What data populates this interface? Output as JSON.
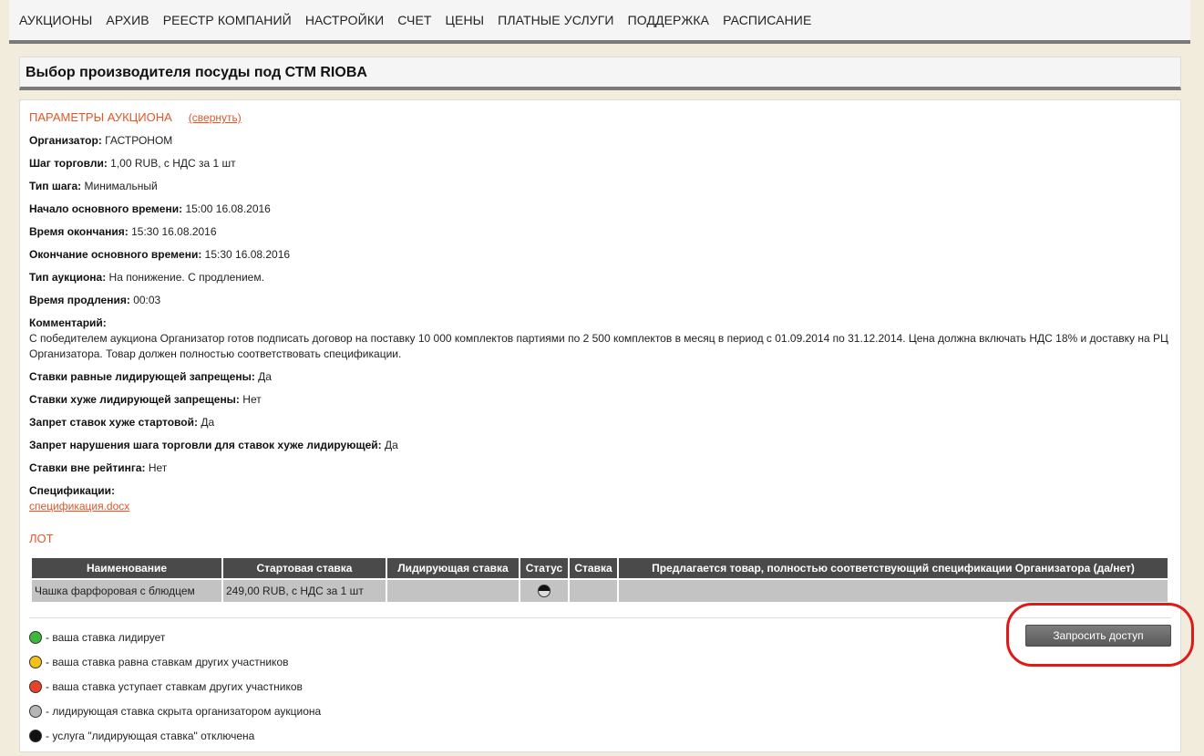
{
  "nav": {
    "items": [
      "АУКЦИОНЫ",
      "АРХИВ",
      "РЕЕСТР КОМПАНИЙ",
      "НАСТРОЙКИ",
      "СЧЕТ",
      "ЦЕНЫ",
      "ПЛАТНЫЕ УСЛУГИ",
      "ПОДДЕРЖКА",
      "РАСПИСАНИЕ"
    ]
  },
  "page": {
    "title": "Выбор производителя посуды под СТМ RIOBA"
  },
  "params": {
    "heading": "ПАРАМЕТРЫ АУКЦИОНА",
    "toggle": "(свернуть)",
    "organizer": {
      "label": "Организатор:",
      "value": "ГАСТРОНОМ"
    },
    "step": {
      "label": "Шаг торговли:",
      "value": "1,00 RUB, с НДС за 1 шт"
    },
    "step_type": {
      "label": "Тип шага:",
      "value": "Минимальный"
    },
    "main_start": {
      "label": "Начало основного времени:",
      "value": "15:00 16.08.2016"
    },
    "end_time": {
      "label": "Время окончания:",
      "value": "15:30 16.08.2016"
    },
    "main_end": {
      "label": "Окончание основного времени:",
      "value": "15:30 16.08.2016"
    },
    "auction_type": {
      "label": "Тип аукциона:",
      "value": "На понижение. С продлением."
    },
    "extension": {
      "label": "Время продления:",
      "value": "00:03"
    },
    "comment": {
      "label": "Комментарий:",
      "value": "С победителем аукциона Организатор готов подписать договор на поставку 10 000 комплектов партиями по 2 500 комплектов в месяц в период с 01.09.2014 по 31.12.2014. Цена должна включать НДС 18% и доставку на РЦ Организатора. Товар должен полностью соответствовать спецификации."
    },
    "equal_forbidden": {
      "label": "Ставки равные лидирующей запрещены:",
      "value": "Да"
    },
    "worse_forbidden": {
      "label": "Ставки хуже лидирующей запрещены:",
      "value": "Нет"
    },
    "worse_start_forbidden": {
      "label": "Запрет ставок хуже стартовой:",
      "value": "Да"
    },
    "step_violation": {
      "label": "Запрет нарушения шага торговли для ставок хуже лидирующей:",
      "value": "Да"
    },
    "off_rating": {
      "label": "Ставки вне рейтинга:",
      "value": "Нет"
    },
    "specs": {
      "label": "Спецификации:",
      "file": "спецификация.docx"
    }
  },
  "lot": {
    "heading": "ЛОТ",
    "columns": [
      "Наименование",
      "Стартовая ставка",
      "Лидирующая ставка",
      "Статус",
      "Ставка",
      "Предлагается товар, полностью соответствующий спецификации Организатора (да/нет)"
    ],
    "row": {
      "name": "Чашка фарфоровая с блюдцем",
      "start_bid": "249,00 RUB, с НДС за 1 шт",
      "leading_bid": "",
      "bid": "",
      "compliance": ""
    }
  },
  "legend": [
    {
      "color": "#3cb93c",
      "text": " - ваша ставка лидирует"
    },
    {
      "color": "#f2c21b",
      "text": " - ваша ставка равна ставкам других участников"
    },
    {
      "color": "#e8432a",
      "text": " - ваша ставка уступает ставкам других участников"
    },
    {
      "color": "#b5b5b5",
      "text": " - лидирующая ставка скрыта организатором аукциона"
    },
    {
      "color": "#111111",
      "text": " - услуга \"лидирующая ставка\" отключена"
    }
  ],
  "actions": {
    "request_access": "Запросить доступ"
  }
}
